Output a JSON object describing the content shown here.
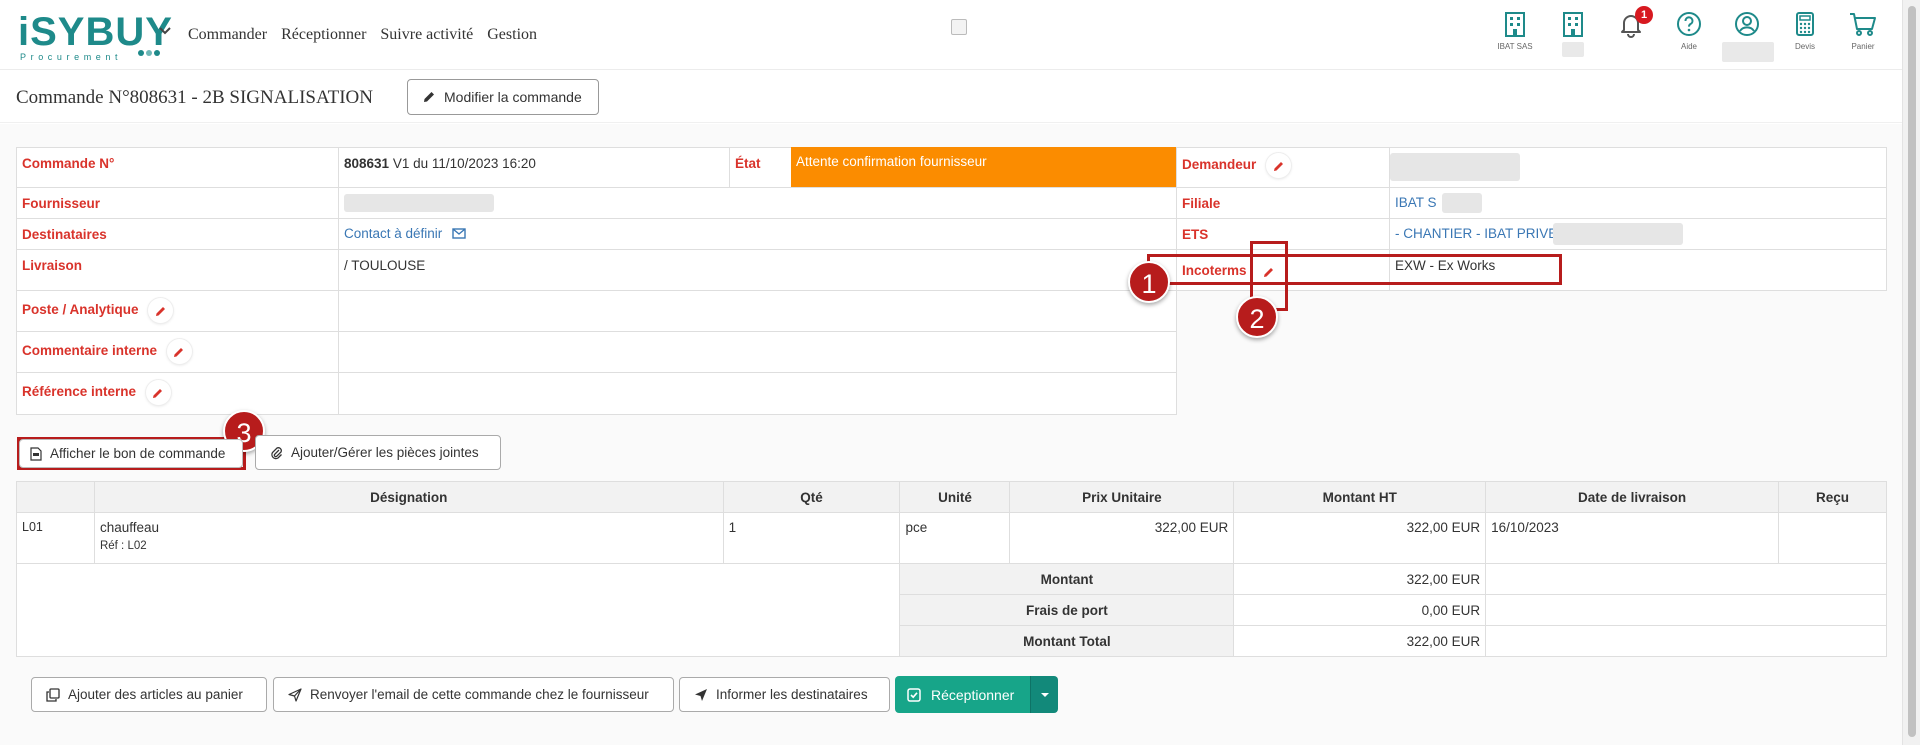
{
  "header": {
    "logo_text": "iSYBUY",
    "logo_subtext": "Procurement",
    "menu": [
      "Commander",
      "Réceptionner",
      "Suivre activité",
      "Gestion"
    ],
    "icons": [
      {
        "name": "building-icon",
        "caption": "IBAT SAS"
      },
      {
        "name": "building-icon",
        "caption": ""
      },
      {
        "name": "bell-icon",
        "caption": "",
        "badge": "1"
      },
      {
        "name": "help-icon",
        "caption": "Aide"
      },
      {
        "name": "user-icon",
        "caption": ""
      },
      {
        "name": "calculator-icon",
        "caption": "Devis"
      },
      {
        "name": "cart-icon",
        "caption": "Panier"
      }
    ],
    "colors": {
      "brand": "#1e8a8a",
      "accent_red": "#d9332b",
      "state_orange": "#fb8c00",
      "green": "#17a589"
    }
  },
  "title": {
    "text": "Commande N°808631 - 2B SIGNALISATION",
    "modify_button": "Modifier la commande"
  },
  "info": {
    "order_label": "Commande N°",
    "order_number": "808631",
    "order_version": " V1 du 11/10/2023 16:20",
    "state_label": "État",
    "state_value": "Attente confirmation fournisseur",
    "supplier_label": "Fournisseur",
    "recipients_label": "Destinataires",
    "recipients_value": "Contact à définir",
    "delivery_label": "Livraison",
    "delivery_value": "/ TOULOUSE",
    "analytic_label": "Poste / Analytique",
    "internal_comment_label": "Commentaire interne",
    "internal_ref_label": "Référence interne",
    "requester_label": "Demandeur",
    "branch_label": "Filiale",
    "branch_value": "IBAT S",
    "ets_label": "ETS",
    "ets_value": "- CHANTIER - IBAT PRIVE",
    "incoterms_label": "Incoterms",
    "incoterms_value": "EXW - Ex Works"
  },
  "annotations": [
    "1",
    "2",
    "3"
  ],
  "actions": {
    "show_po": "Afficher le bon de commande",
    "attachments": "Ajouter/Gérer les pièces jointes"
  },
  "items": {
    "headers": [
      "",
      "Désignation",
      "Qté",
      "Unité",
      "Prix Unitaire",
      "Montant HT",
      "Date de livraison",
      "Reçu"
    ],
    "rows": [
      {
        "line": "L01",
        "designation": "chauffeau",
        "ref": "Réf : L02",
        "qty": "1",
        "unit": "pce",
        "unit_price": "322,00 EUR",
        "amount": "322,00 EUR",
        "delivery_date": "16/10/2023",
        "received": ""
      }
    ],
    "totals": [
      {
        "label": "Montant",
        "value": "322,00 EUR"
      },
      {
        "label": "Frais de port",
        "value": "0,00 EUR"
      },
      {
        "label": "Montant Total",
        "value": "322,00 EUR"
      }
    ]
  },
  "footer": {
    "add_to_cart": "Ajouter des articles au panier",
    "resend_email": "Renvoyer l'email de cette commande chez le fournisseur",
    "notify_recipients": "Informer les destinataires",
    "receive": "Réceptionner"
  }
}
